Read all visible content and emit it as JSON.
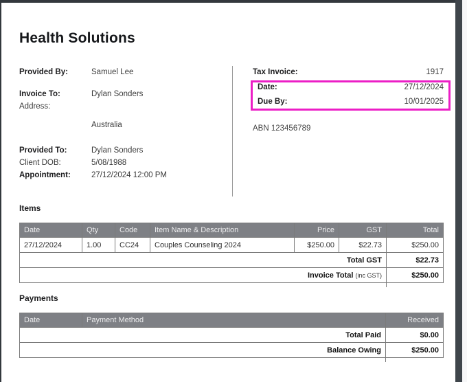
{
  "doc": {
    "title": "Health Solutions"
  },
  "colors": {
    "highlight_box": "#ec1ec6",
    "table_header_bg": "#7e8085",
    "table_header_text": "#ededef",
    "chrome_dark": "#33383d",
    "scrollbar_thumb": "#3f454b"
  },
  "info_left": {
    "rows": [
      {
        "label": "Provided By:",
        "value": "Samuel Lee"
      },
      {
        "label": "Invoice To:",
        "value": "Dylan Sonders"
      },
      {
        "label": "Address:",
        "value": ""
      },
      {
        "label": "",
        "value": "Australia"
      },
      {
        "label": "Provided To:",
        "value": "Dylan Sonders"
      },
      {
        "label": "Client DOB:",
        "value": "5/08/1988"
      },
      {
        "label": "Appointment:",
        "value": "27/12/2024 12:00 PM"
      }
    ]
  },
  "invoice_meta": {
    "tax_invoice_label": "Tax Invoice:",
    "tax_invoice_value": "1917",
    "date_label": "Date:",
    "date_value": "27/12/2024",
    "due_by_label": "Due By:",
    "due_by_value": "10/01/2025",
    "abn": "ABN 123456789"
  },
  "items_section": {
    "heading": "Items",
    "headers": [
      "Date",
      "Qty",
      "Code",
      "Item Name & Description",
      "Price",
      "GST",
      "Total"
    ],
    "rows": [
      {
        "date": "27/12/2024",
        "qty": "1.00",
        "code": "CC24",
        "description": "Couples Counseling 2024",
        "price": "$250.00",
        "gst": "$22.73",
        "total": "$250.00"
      }
    ],
    "total_gst_label": "Total GST",
    "total_gst_value": "$22.73",
    "invoice_total_label": "Invoice Total",
    "invoice_total_note": "(inc GST)",
    "invoice_total_value": "$250.00"
  },
  "payments_section": {
    "heading": "Payments",
    "headers": [
      "Date",
      "Payment Method",
      "Received"
    ],
    "total_paid_label": "Total Paid",
    "total_paid_value": "$0.00",
    "balance_owing_label": "Balance Owing",
    "balance_owing_value": "$250.00"
  }
}
